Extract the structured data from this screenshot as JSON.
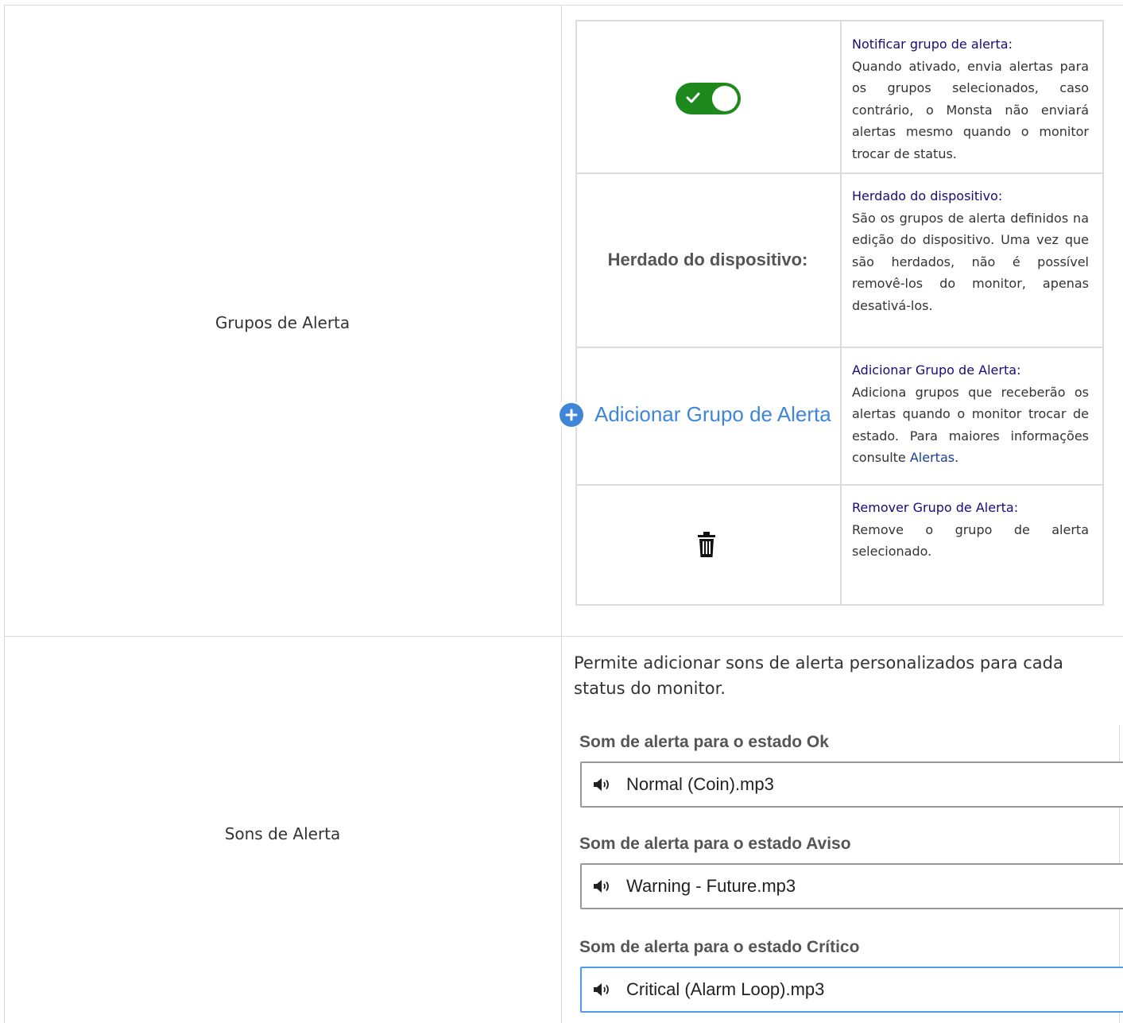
{
  "rows": {
    "groups_label": "Grupos de Alerta",
    "sounds_label": "Sons de Alerta"
  },
  "inner_table": {
    "notify": {
      "title": "Notificar grupo de alerta:",
      "text": "Quando ativado, envia alertas para os grupos selecionados, caso contrário, o Monsta não enviará alertas mesmo quando o monitor trocar de status.",
      "toggle_on": true
    },
    "inherited": {
      "label": "Herdado do dispositivo:",
      "title": "Herdado do dispositivo:",
      "text": "São os grupos de alerta definidos na edição do dispositivo. Uma vez que são herdados, não é possível removê-los do monitor, apenas desativá-los."
    },
    "add": {
      "button_label": "Adicionar Grupo de Alerta",
      "title": "Adicionar Grupo de Alerta:",
      "text": "Adiciona grupos que receberão os alertas quando o monitor trocar de estado. Para maiores informações consulte ",
      "link": "Alertas",
      "text_end": "."
    },
    "remove": {
      "title": "Remover Grupo de Alerta:",
      "text": "Remove o grupo de alerta selecionado."
    }
  },
  "sounds": {
    "intro": "Permite adicionar sons de alerta personalizados para cada status do monitor.",
    "items": [
      {
        "label": "Som de alerta para o estado Ok",
        "value": "Normal (Coin).mp3"
      },
      {
        "label": "Som de alerta para o estado Aviso",
        "value": "Warning - Future.mp3"
      },
      {
        "label": "Som de alerta para o estado Crítico",
        "value": "Critical (Alarm Loop).mp3"
      }
    ]
  },
  "colors": {
    "toggle_on": "#1e8a1e",
    "link_blue": "#3f86d9",
    "title_navy": "#1a0a7a",
    "focus_border": "#4e9be8"
  }
}
